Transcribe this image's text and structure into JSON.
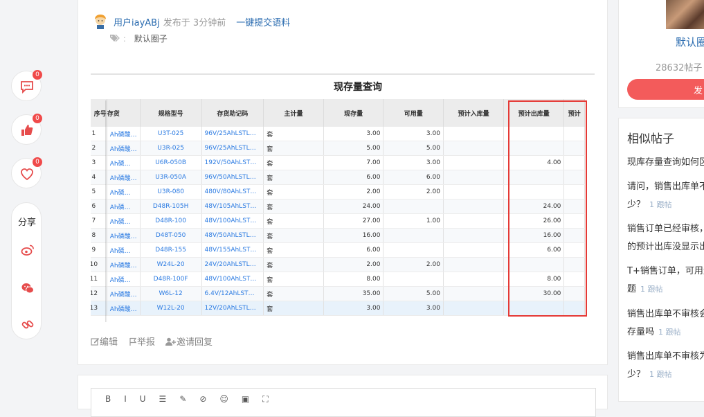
{
  "left_bar": {
    "comment_count": "0",
    "like_count": "0",
    "favorite_count": "0",
    "share_label": "分享"
  },
  "post": {
    "author": "用户iayABj",
    "posted": "发布于 3分钟前",
    "submit_corpus": "一键提交语料",
    "tag": "默认圈子"
  },
  "screenshot": {
    "title": "现存量查询",
    "columns": [
      "序号",
      "存货",
      "规格型号",
      "存货助记码",
      "主计量",
      "现存量",
      "可用量",
      "预计入库量",
      "预计出库量",
      "预计"
    ],
    "rows": [
      [
        "1",
        "Ah磷酸…",
        "U3T-025",
        "96V/25AhLSTL…",
        "套",
        "3.00",
        "3.00",
        "",
        ""
      ],
      [
        "2",
        "Ah磷酸…",
        "U3R-025",
        "96V/25AhLSTL…",
        "套",
        "5.00",
        "5.00",
        "",
        ""
      ],
      [
        "3",
        "Ah磷…",
        "U6R-050B",
        "192V/50AhLST…",
        "套",
        "7.00",
        "3.00",
        "",
        "4.00"
      ],
      [
        "4",
        "Ah磷酸…",
        "U3R-050A",
        "96V/50AhLSTL…",
        "套",
        "6.00",
        "6.00",
        "",
        ""
      ],
      [
        "5",
        "Ah磷…",
        "U3R-080",
        "480V/80AhLST…",
        "套",
        "2.00",
        "2.00",
        "",
        ""
      ],
      [
        "6",
        "Ah磷…",
        "D48R-105H",
        "48V/105AhLST…",
        "套",
        "24.00",
        "",
        "",
        "24.00"
      ],
      [
        "7",
        "Ah磷…",
        "D48R-100",
        "48V/100AhLST…",
        "套",
        "27.00",
        "1.00",
        "",
        "26.00"
      ],
      [
        "8",
        "Ah磷酸…",
        "D48T-050",
        "48V/50AhLSTL…",
        "套",
        "16.00",
        "",
        "",
        "16.00"
      ],
      [
        "9",
        "Ah磷…",
        "D48R-155",
        "48V/155AhLST…",
        "套",
        "6.00",
        "",
        "",
        "6.00"
      ],
      [
        "10",
        "Ah磷酸…",
        "W24L-20",
        "24V/20AhLSTL…",
        "套",
        "2.00",
        "2.00",
        "",
        ""
      ],
      [
        "11",
        "Ah磷…",
        "D48R-100F",
        "48V/100AhLST…",
        "套",
        "8.00",
        "",
        "",
        "8.00"
      ],
      [
        "12",
        "Ah磷酸…",
        "W6L-12",
        "6.4V/12AhLST…",
        "套",
        "35.00",
        "5.00",
        "",
        "30.00"
      ],
      [
        "13",
        "Ah磷酸…",
        "W12L-20",
        "12V/20AhLSTL…",
        "套",
        "3.00",
        "3.00",
        "",
        ""
      ]
    ]
  },
  "actions": {
    "edit": "编辑",
    "report": "举报",
    "invite": "邀请回复"
  },
  "sidebar": {
    "circle_name": "默认圈",
    "posts_count": "28632帖子",
    "post_button": "发",
    "similar_title": "相似帖子",
    "similar": [
      {
        "line1": "现库存量查询如何区",
        "line2": "",
        "follow": ""
      },
      {
        "line1": "请问，销售出库单不",
        "line2": "少？",
        "follow": "1 跟帖"
      },
      {
        "line1": "销售订单已经审核，",
        "line2": "的预计出库没显示出",
        "follow": ""
      },
      {
        "line1": "T+销售订单，可用量",
        "line2": "题",
        "follow": "1 跟帖"
      },
      {
        "line1": "销售出库单不审核会",
        "line2": "存量吗",
        "follow": "1 跟帖"
      },
      {
        "line1": "销售出库单不审核为",
        "line2": "少？",
        "follow": "1 跟帖"
      }
    ]
  },
  "colors": {
    "accent_blue": "#2b6cb0",
    "badge_red": "#f04a4a",
    "highlight_red": "#e53935",
    "button_red": "#f35b5b"
  }
}
